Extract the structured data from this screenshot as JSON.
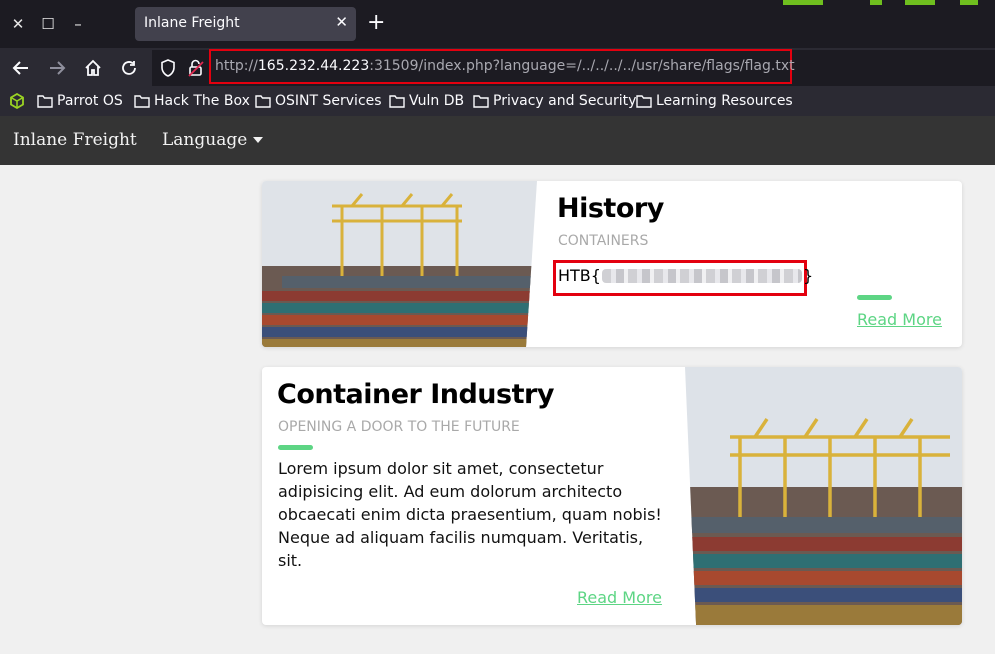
{
  "browser": {
    "tab_title": "Inlane Freight",
    "url_prefix": "http://",
    "url_host": "165.232.44.223",
    "url_rest": ":31509/index.php?language=/../../../../usr/share/flags/flag.txt",
    "bookmarks": [
      {
        "label": "Parrot OS"
      },
      {
        "label": "Hack The Box"
      },
      {
        "label": "OSINT Services"
      },
      {
        "label": "Vuln DB"
      },
      {
        "label": "Privacy and Security"
      },
      {
        "label": "Learning Resources"
      }
    ]
  },
  "site": {
    "brand": "Inlane Freight",
    "language_menu": "Language"
  },
  "cards": [
    {
      "title": "History",
      "subtitle": "CONTAINERS",
      "flag_prefix": "HTB{",
      "flag_suffix": "}",
      "read_more": "Read More"
    },
    {
      "title": "Container Industry",
      "subtitle": "OPENING A DOOR TO THE FUTURE",
      "body": "Lorem ipsum dolor sit amet, consectetur adipisicing elit. Ad eum dolorum architecto obcaecati enim dicta praesentium, quam nobis! Neque ad aliquam facilis numquam. Veritatis, sit.",
      "read_more": "Read More"
    }
  ],
  "colors": {
    "accent": "#5dd584",
    "highlight": "#e3000f",
    "header_bg": "#343434"
  }
}
